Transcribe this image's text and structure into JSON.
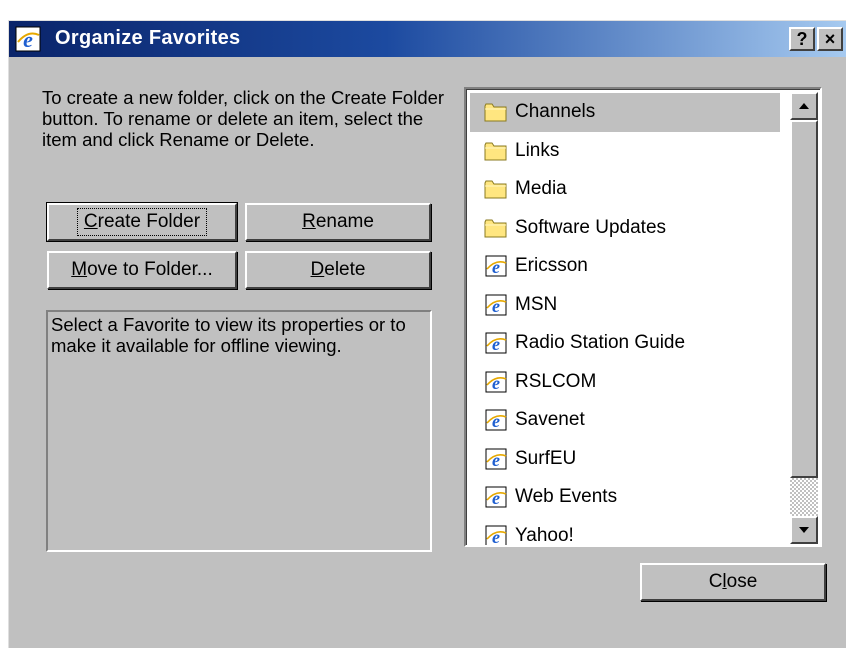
{
  "window": {
    "title": "Organize Favorites",
    "help_label": "?",
    "close_glyph": "×",
    "title_icon": "ie-icon"
  },
  "instructions": "To create a new folder, click on the Create Folder button. To rename or delete an item, select the item and click Rename or Delete.",
  "buttons": {
    "create_folder": {
      "pre": "",
      "key": "C",
      "post": "reate Folder"
    },
    "rename": {
      "pre": "",
      "key": "R",
      "post": "ename"
    },
    "move_to_folder": {
      "pre": "",
      "key": "M",
      "post": "ove to Folder..."
    },
    "delete": {
      "pre": "",
      "key": "D",
      "post": "elete"
    },
    "close": {
      "pre": "C",
      "key": "l",
      "post": "ose"
    }
  },
  "info_text": "Select a Favorite to view its properties or to make it available for offline viewing.",
  "favorites": [
    {
      "label": "Channels",
      "icon": "folder-icon",
      "selected": true
    },
    {
      "label": "Links",
      "icon": "folder-icon"
    },
    {
      "label": "Media",
      "icon": "folder-icon"
    },
    {
      "label": "Software Updates",
      "icon": "folder-icon"
    },
    {
      "label": "Ericsson",
      "icon": "ie-link-icon"
    },
    {
      "label": "MSN",
      "icon": "ie-link-icon"
    },
    {
      "label": "Radio Station Guide",
      "icon": "ie-link-icon"
    },
    {
      "label": "RSLCOM",
      "icon": "ie-link-icon"
    },
    {
      "label": "Savenet",
      "icon": "ie-link-icon"
    },
    {
      "label": "SurfEU",
      "icon": "ie-link-icon"
    },
    {
      "label": "Web Events",
      "icon": "ie-link-icon"
    },
    {
      "label": "Yahoo!",
      "icon": "ie-link-icon"
    }
  ],
  "colors": {
    "title_gradient_start": "#0a246a",
    "title_gradient_end": "#a6caf0",
    "dialog_face": "#c0c0c0",
    "folder_yellow": "#ffe680"
  }
}
